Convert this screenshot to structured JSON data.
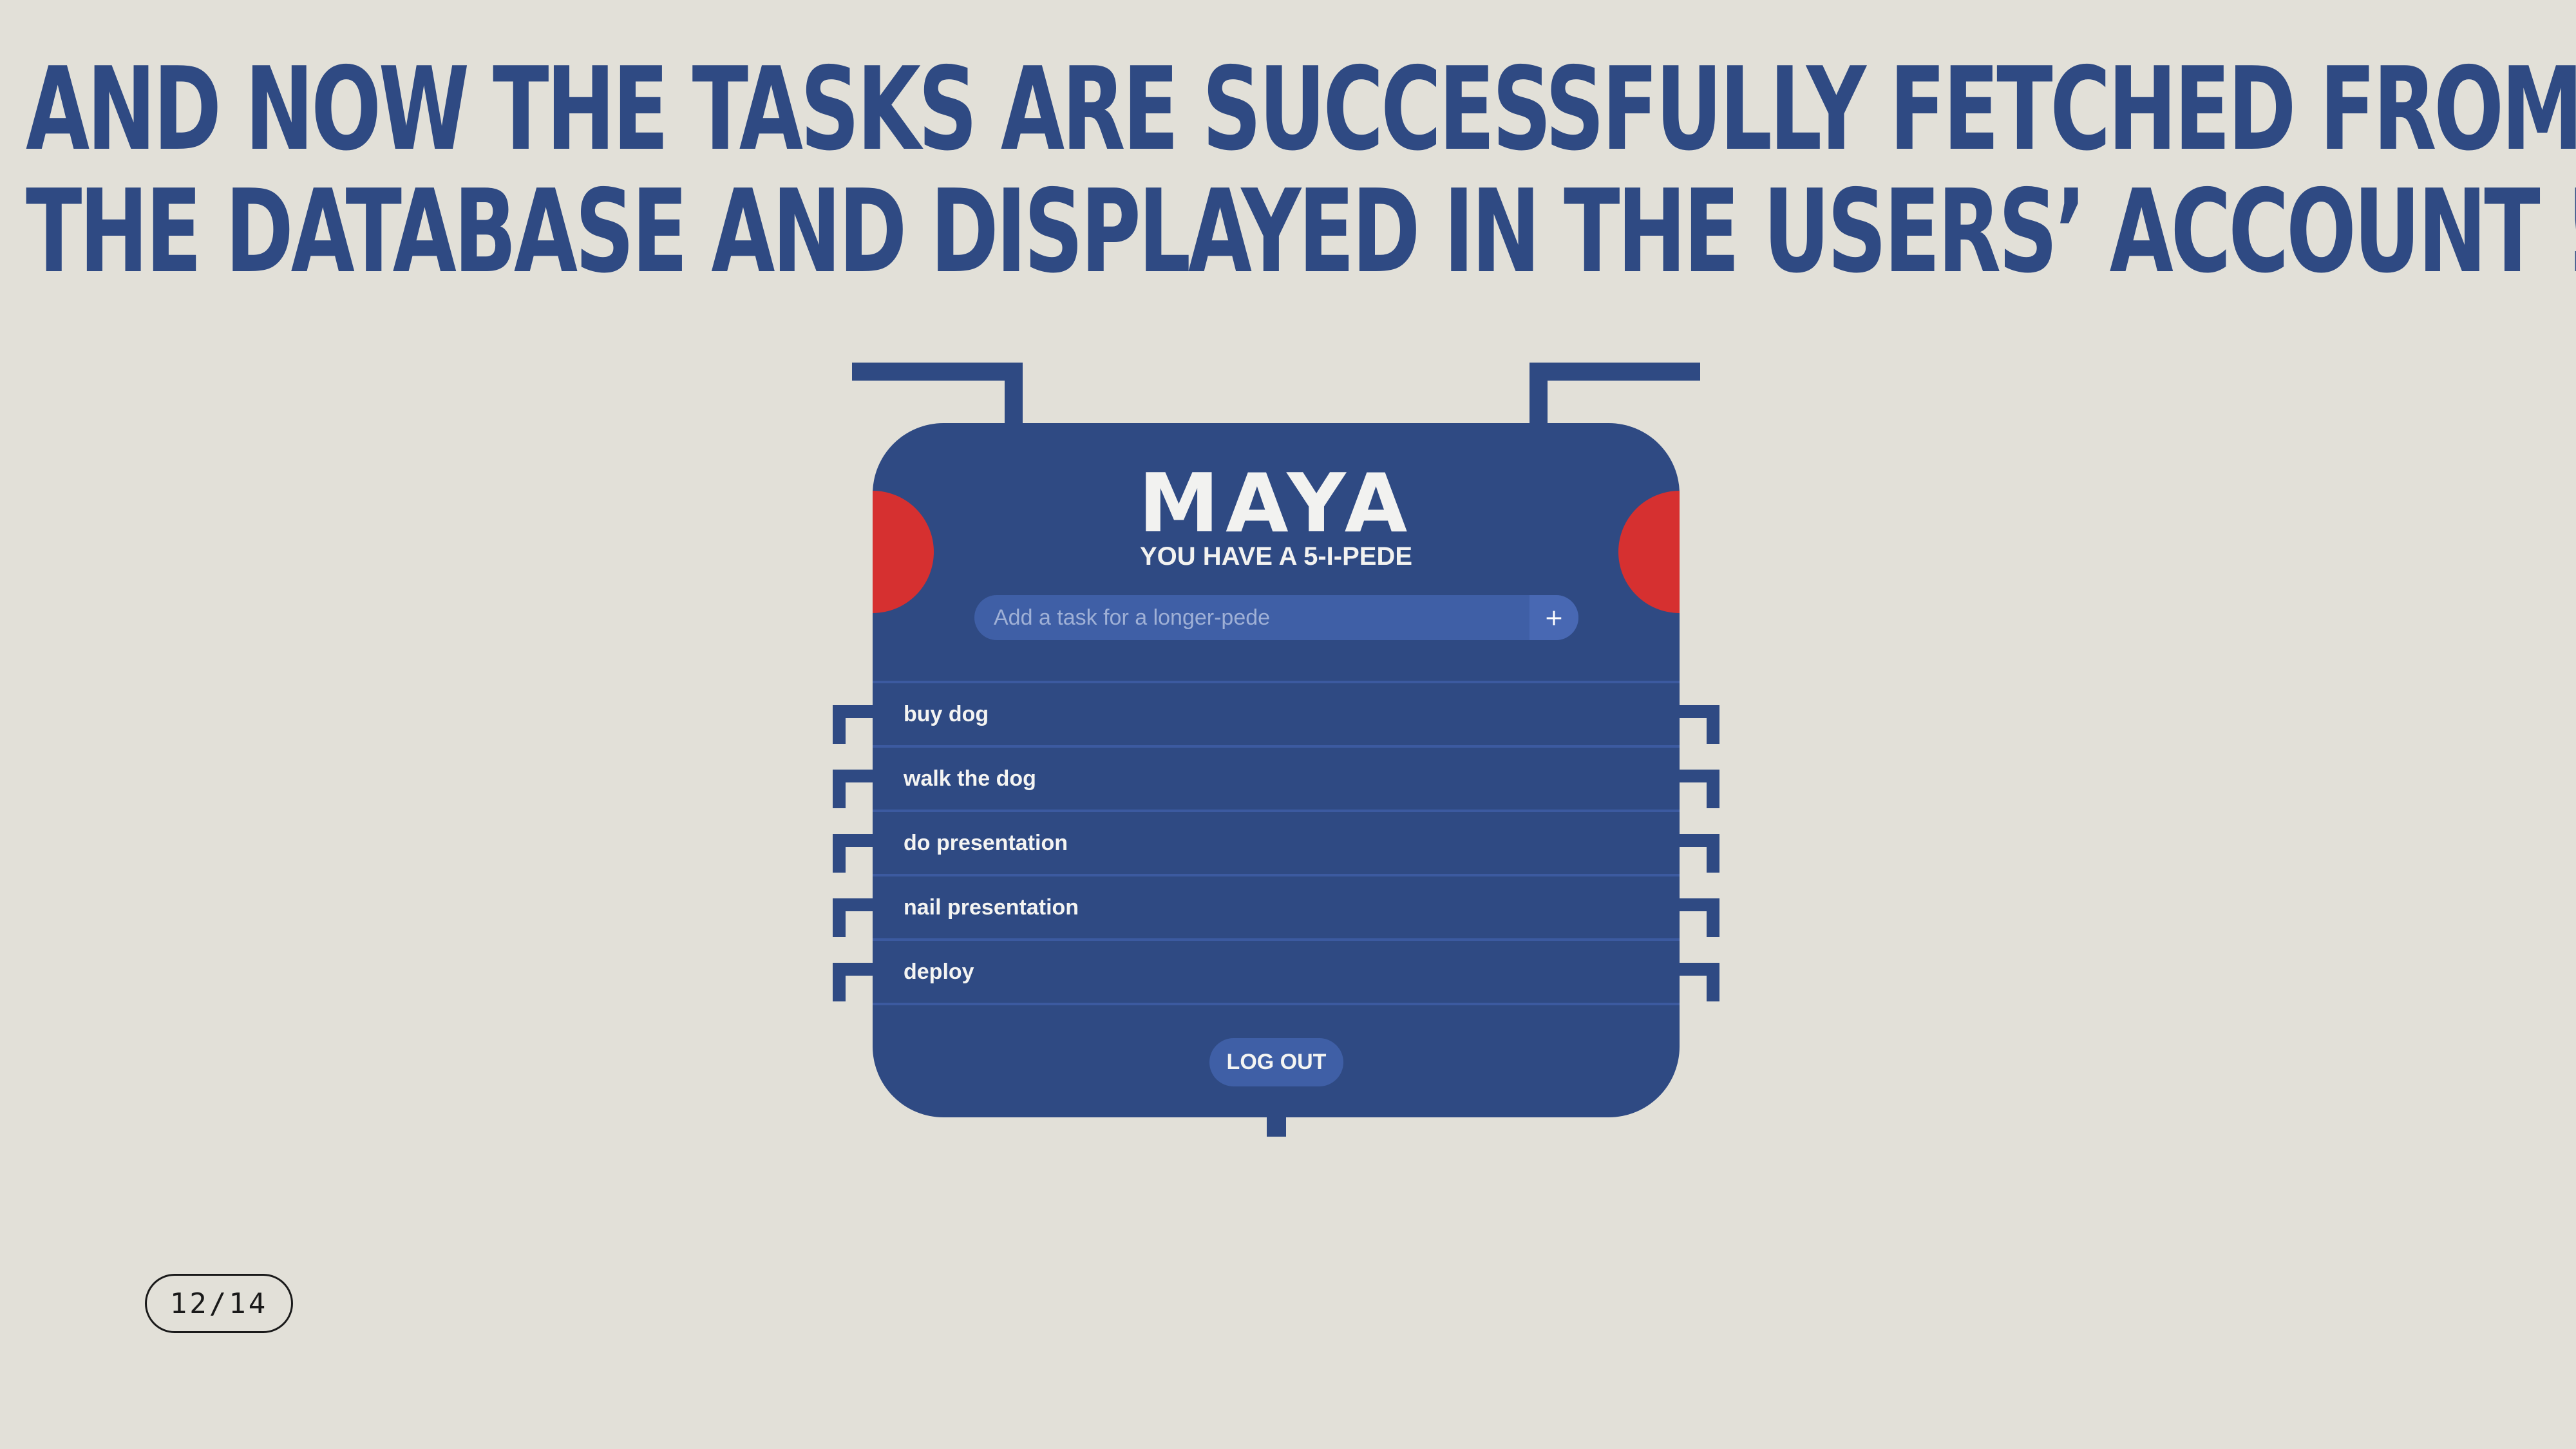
{
  "slide": {
    "headline_line1": "AND NOW THE TASKS ARE SUCCESSFULLY FETCHED FROM",
    "headline_line2": "THE DATABASE AND DISPLAYED IN THE USERS’ ACCOUNT !!",
    "page_indicator": "12/14"
  },
  "app": {
    "logo": "MAYA",
    "subtitle": "YOU HAVE A 5-I-PEDE",
    "input_placeholder": "Add a task for a longer-pede",
    "add_label": "+",
    "tasks": [
      "buy dog",
      "walk the dog",
      "do presentation",
      "nail presentation",
      "deploy"
    ],
    "logout_label": "LOG OUT"
  },
  "colors": {
    "background": "#e2e0d8",
    "primary": "#2f4a83",
    "accent": "#d63030",
    "input": "#3f5fa6"
  }
}
